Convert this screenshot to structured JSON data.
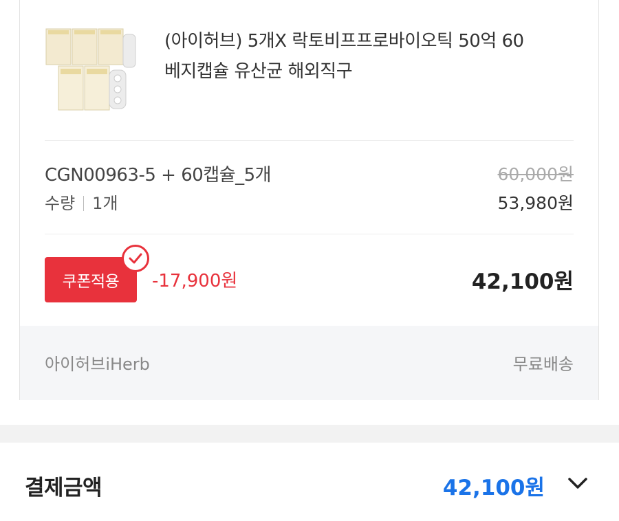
{
  "product": {
    "title_line1": "(아이허브) 5개X 락토비프프로바이오틱 50억 60",
    "title_line2": "베지캡슐 유산균 해외직구",
    "image_icon": "product-thumbnail"
  },
  "option": {
    "name": "CGN00963-5 + 60캡슐_5개",
    "qty_label": "수량",
    "qty_value": "1개",
    "original_price": "60,000원",
    "sale_price": "53,980원"
  },
  "coupon": {
    "button_label": "쿠폰적용",
    "discount": "-17,900원",
    "final_price": "42,100원",
    "color": "#e8323c"
  },
  "footer": {
    "seller": "아이허브iHerb",
    "shipping": "무료배송"
  },
  "payment": {
    "label": "결제금액",
    "amount": "42,100원",
    "accent": "#1a73e8",
    "toggle_icon": "chevron-down-icon"
  }
}
